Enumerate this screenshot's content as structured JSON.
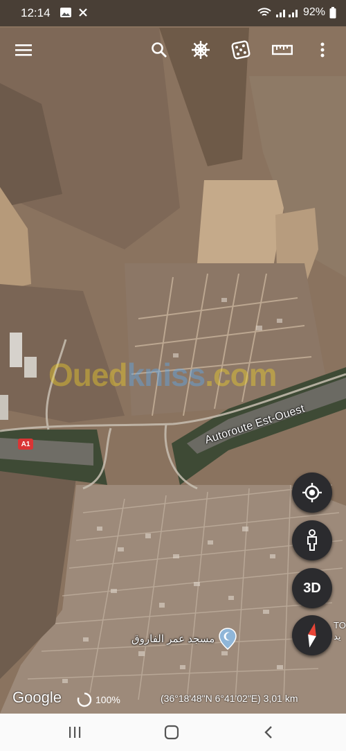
{
  "status_bar": {
    "time": "12:14",
    "battery": "92%",
    "icons": [
      "image-icon",
      "x-icon",
      "wifi-icon",
      "signal-icon",
      "battery-icon"
    ]
  },
  "toolbar": {
    "buttons": [
      "menu-icon",
      "search-icon",
      "voyager-icon",
      "feeling-lucky-icon",
      "measure-icon",
      "more-icon"
    ]
  },
  "map": {
    "road_label": "Autoroute Est-Ouest",
    "road_shield": "A1",
    "watermark_part1": "Oued",
    "watermark_part2": "kniss",
    "watermark_part3": ".com",
    "poi_name": "مسجد عمر الفاروق",
    "edge_text_1": "TO",
    "edge_text_2": "يد"
  },
  "controls": {
    "locate_icon": "my-location-icon",
    "pegman_icon": "pegman-icon",
    "three_d_label": "3D",
    "compass_icon": "compass-icon"
  },
  "footer": {
    "brand": "Google",
    "zoom": "100%",
    "coordinates": "(36°18'48\"N 6°41'02\"E) 3,01 km"
  },
  "nav_bar": {
    "buttons": [
      "recents-icon",
      "home-icon",
      "back-icon"
    ]
  }
}
